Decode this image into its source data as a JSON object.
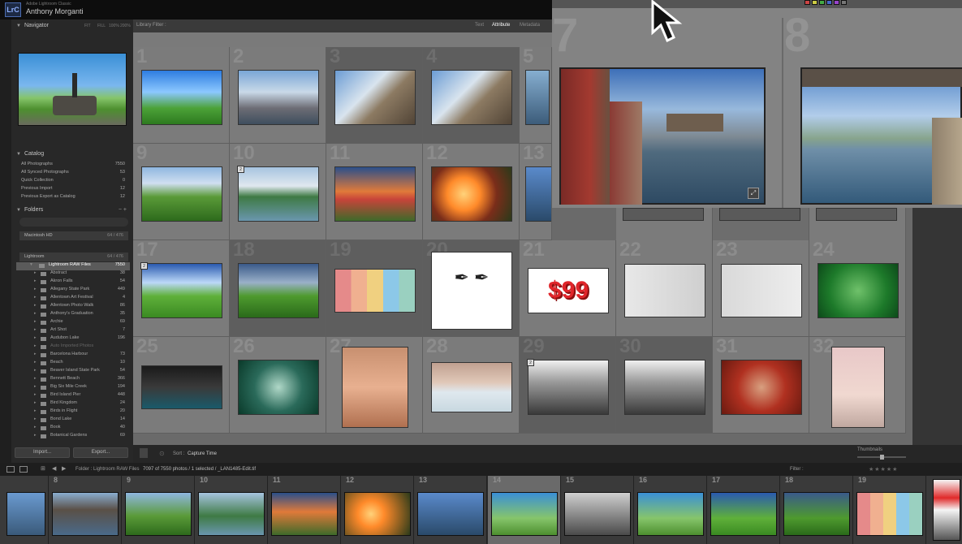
{
  "titlebar": {
    "app_icon": "LrC",
    "app_name": "Adobe Lightroom Classic",
    "user_name": "Anthony Morganti"
  },
  "navigator": {
    "title": "Navigator",
    "zoom_options": [
      "FIT",
      "FILL",
      "100%",
      "200%"
    ]
  },
  "catalog": {
    "title": "Catalog",
    "items": [
      {
        "label": "All Photographs",
        "count": "7550"
      },
      {
        "label": "All Synced Photographs",
        "count": "53"
      },
      {
        "label": "Quick Collection",
        "count": "0"
      },
      {
        "label": "Previous Import",
        "count": "12"
      },
      {
        "label": "Previous Export as Catalog",
        "count": "12"
      }
    ]
  },
  "folders": {
    "title": "Folders",
    "volumes": [
      {
        "label": "Macintosh HD",
        "value": "64 / 476"
      },
      {
        "label": "Lightroom",
        "value": "64 / 476"
      }
    ],
    "items": [
      {
        "label": "Lightroom RAW Files",
        "count": "7550",
        "selected": true
      },
      {
        "label": "Abstract",
        "count": "38"
      },
      {
        "label": "Akron Falls",
        "count": "54"
      },
      {
        "label": "Allegany State Park",
        "count": "449"
      },
      {
        "label": "Allentown Art Festival",
        "count": "4"
      },
      {
        "label": "Allentown Photo Walk",
        "count": "86"
      },
      {
        "label": "Anthony's Graduation",
        "count": "35"
      },
      {
        "label": "Archie",
        "count": "69"
      },
      {
        "label": "Art Shot",
        "count": "7"
      },
      {
        "label": "Audubon Lake",
        "count": "196"
      },
      {
        "label": "Auto Imported Photos",
        "count": "",
        "dim": true
      },
      {
        "label": "Barcelona Harbour",
        "count": "73"
      },
      {
        "label": "Beach",
        "count": "10"
      },
      {
        "label": "Beaver Island State Park",
        "count": "54"
      },
      {
        "label": "Bennett Beach",
        "count": "366"
      },
      {
        "label": "Big Six Mile Creek",
        "count": "194"
      },
      {
        "label": "Bird Island Pier",
        "count": "448"
      },
      {
        "label": "Bird Kingdom",
        "count": "24"
      },
      {
        "label": "Birds in Flight",
        "count": "20"
      },
      {
        "label": "Bond Lake",
        "count": "14"
      },
      {
        "label": "Book",
        "count": "40"
      },
      {
        "label": "Botanical Gardens",
        "count": "69"
      }
    ]
  },
  "buttons": {
    "import": "Import...",
    "export": "Export..."
  },
  "library_filter": {
    "label": "Library Filter :",
    "tabs": [
      "Text",
      "Attribute",
      "Metadata"
    ],
    "active": "Attribute"
  },
  "grid": {
    "cells": [
      {
        "n": "1"
      },
      {
        "n": "2"
      },
      {
        "n": "3"
      },
      {
        "n": "4"
      },
      {
        "n": "5"
      },
      {
        "n": "9"
      },
      {
        "n": "10"
      },
      {
        "n": "11"
      },
      {
        "n": "12"
      },
      {
        "n": "13"
      },
      {
        "n": "17"
      },
      {
        "n": "18"
      },
      {
        "n": "19"
      },
      {
        "n": "20"
      },
      {
        "n": "21"
      },
      {
        "n": "22"
      },
      {
        "n": "23"
      },
      {
        "n": "24"
      },
      {
        "n": "25"
      },
      {
        "n": "26"
      },
      {
        "n": "27"
      },
      {
        "n": "28"
      },
      {
        "n": "29"
      },
      {
        "n": "30"
      },
      {
        "n": "31"
      },
      {
        "n": "32"
      }
    ],
    "price_text": "$99",
    "loupe_numbers": [
      "7",
      "8"
    ]
  },
  "toolbar": {
    "sort_label": "Sort :",
    "sort_value": "Capture Time",
    "thumbnails_label": "Thumbnails"
  },
  "filmstrip_bar": {
    "path": "Folder : Lightroom RAW Files",
    "status": "7097 of 7550 photos / 1 selected / _LAN1485-Edit.tif",
    "filter_label": "Filter :"
  },
  "filmstrip": {
    "numbers": [
      "",
      "8",
      "9",
      "10",
      "11",
      "12",
      "13",
      "14",
      "15",
      "16",
      "17",
      "18",
      "19"
    ]
  },
  "colors": {
    "accent": "#4a6bb0",
    "selected_row": "#5a5a5a",
    "grid_bg": "#7b7b7b"
  }
}
